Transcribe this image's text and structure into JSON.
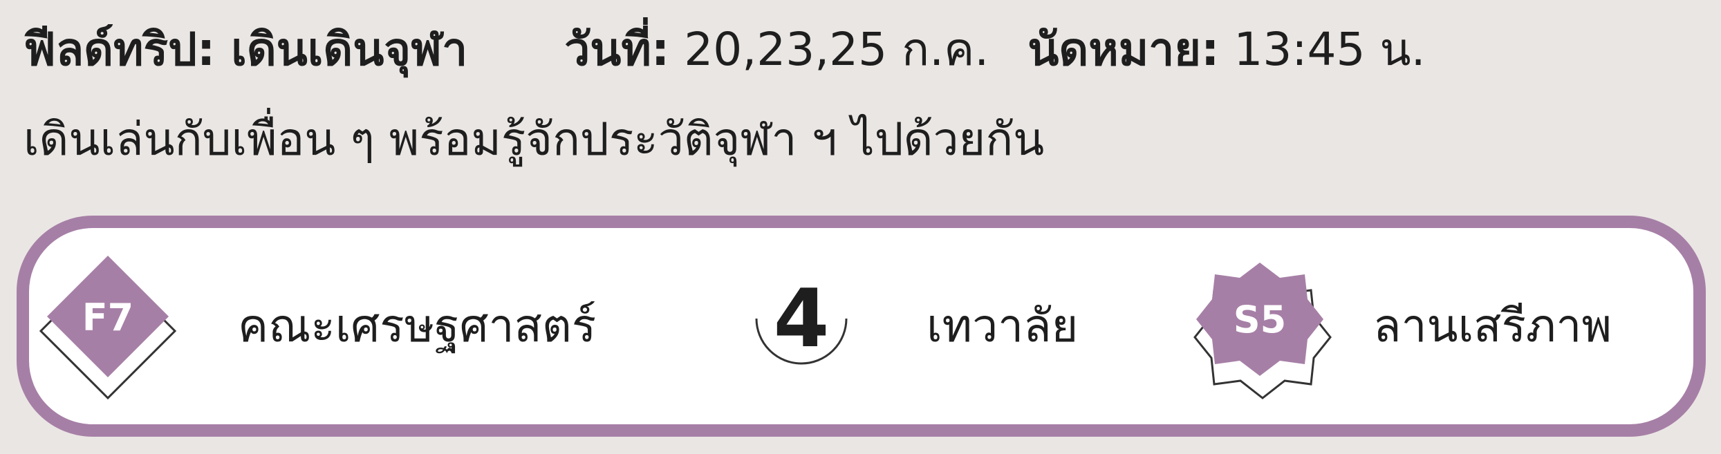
{
  "header": {
    "trip_label": "ฟีลด์ทริป: เดินเดินจุฬา",
    "date_label": "วันที่:",
    "date_value": "20,23,25 ก.ค.",
    "appointment_label": "นัดหมาย:",
    "appointment_value": "13:45 น."
  },
  "description": "เดินเล่นกับเพื่อน ๆ พร้อมรู้จักประวัติจุฬา ฯ ไปด้วยกัน",
  "stops": [
    {
      "code": "F7",
      "name": "คณะเศรษฐศาสตร์",
      "icon": "diamond-icon"
    },
    {
      "code": "4",
      "name": "เทวาลัย",
      "icon": "circle-icon"
    },
    {
      "code": "S5",
      "name": "ลานเสรีภาพ",
      "icon": "star-icon"
    }
  ],
  "colors": {
    "accent": "#a67fa6",
    "background": "#eae6e4",
    "card": "#ffffff",
    "text": "#1e1e1e"
  }
}
